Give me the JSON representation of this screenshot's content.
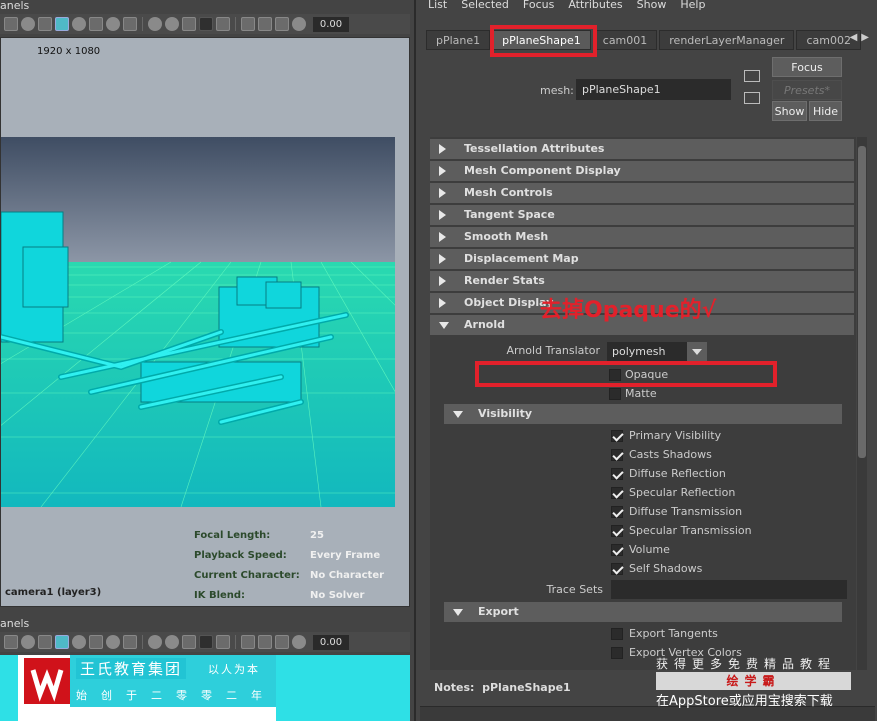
{
  "viewport_top": {
    "caption": "anels",
    "resolution_gate": "1920 x 1080",
    "camera_label": "camera1 (layer3)",
    "toolbar_value": "0.00",
    "hud": [
      {
        "label": "Focal Length:",
        "value": "25"
      },
      {
        "label": "Playback Speed:",
        "value": "Every Frame"
      },
      {
        "label": "Current Character:",
        "value": "No Character"
      },
      {
        "label": "IK Blend:",
        "value": "No Solver"
      }
    ]
  },
  "viewport_bottom": {
    "caption": "anels",
    "toolbar_value": "0.00"
  },
  "logo": {
    "name": "王氏教育集团",
    "slogan": "以人为本",
    "since": "始创于二零零二年"
  },
  "attribute_editor": {
    "menu": [
      "List",
      "Selected",
      "Focus",
      "Attributes",
      "Show",
      "Help"
    ],
    "tabs": [
      {
        "label": "pPlane1",
        "active": false
      },
      {
        "label": "pPlaneShape1",
        "active": true
      },
      {
        "label": "cam001",
        "active": false
      },
      {
        "label": "renderLayerManager",
        "active": false
      },
      {
        "label": "cam002",
        "active": false
      }
    ],
    "mesh_label": "mesh:",
    "mesh_value": "pPlaneShape1",
    "buttons": {
      "focus": "Focus",
      "presets": "Presets*",
      "show": "Show",
      "hide": "Hide"
    },
    "collapsed_sections": [
      "Tessellation Attributes",
      "Mesh Component Display",
      "Mesh Controls",
      "Tangent Space",
      "Smooth Mesh",
      "Displacement Map",
      "Render Stats",
      "Object Display"
    ],
    "arnold": {
      "title": "Arnold",
      "translator_label": "Arnold Translator",
      "translator_value": "polymesh",
      "opaque": {
        "label": "Opaque",
        "checked": false
      },
      "matte": {
        "label": "Matte",
        "checked": false
      }
    },
    "visibility": {
      "title": "Visibility",
      "items": [
        {
          "label": "Primary Visibility",
          "checked": true
        },
        {
          "label": "Casts Shadows",
          "checked": true
        },
        {
          "label": "Diffuse Reflection",
          "checked": true
        },
        {
          "label": "Specular Reflection",
          "checked": true
        },
        {
          "label": "Diffuse Transmission",
          "checked": true
        },
        {
          "label": "Specular Transmission",
          "checked": true
        },
        {
          "label": "Volume",
          "checked": true
        },
        {
          "label": "Self Shadows",
          "checked": true
        }
      ],
      "trace_sets_label": "Trace Sets"
    },
    "export": {
      "title": "Export",
      "items": [
        {
          "label": "Export Tangents",
          "checked": false
        },
        {
          "label": "Export Vertex Colors",
          "checked": false
        }
      ]
    },
    "notes_label": "Notes:",
    "notes_value": "pPlaneShape1"
  },
  "annotation": {
    "text": "去掉Opaque的√",
    "color": "#e2212b"
  },
  "watermark": {
    "line1": "获得更多免费精品教程",
    "brand": "绘学霸",
    "line2": "在AppStore或应用宝搜索下载"
  },
  "colors": {
    "scene_cyan": "#19d7dc",
    "panel_bg": "#444444",
    "section_bg": "#5d5d5d"
  }
}
